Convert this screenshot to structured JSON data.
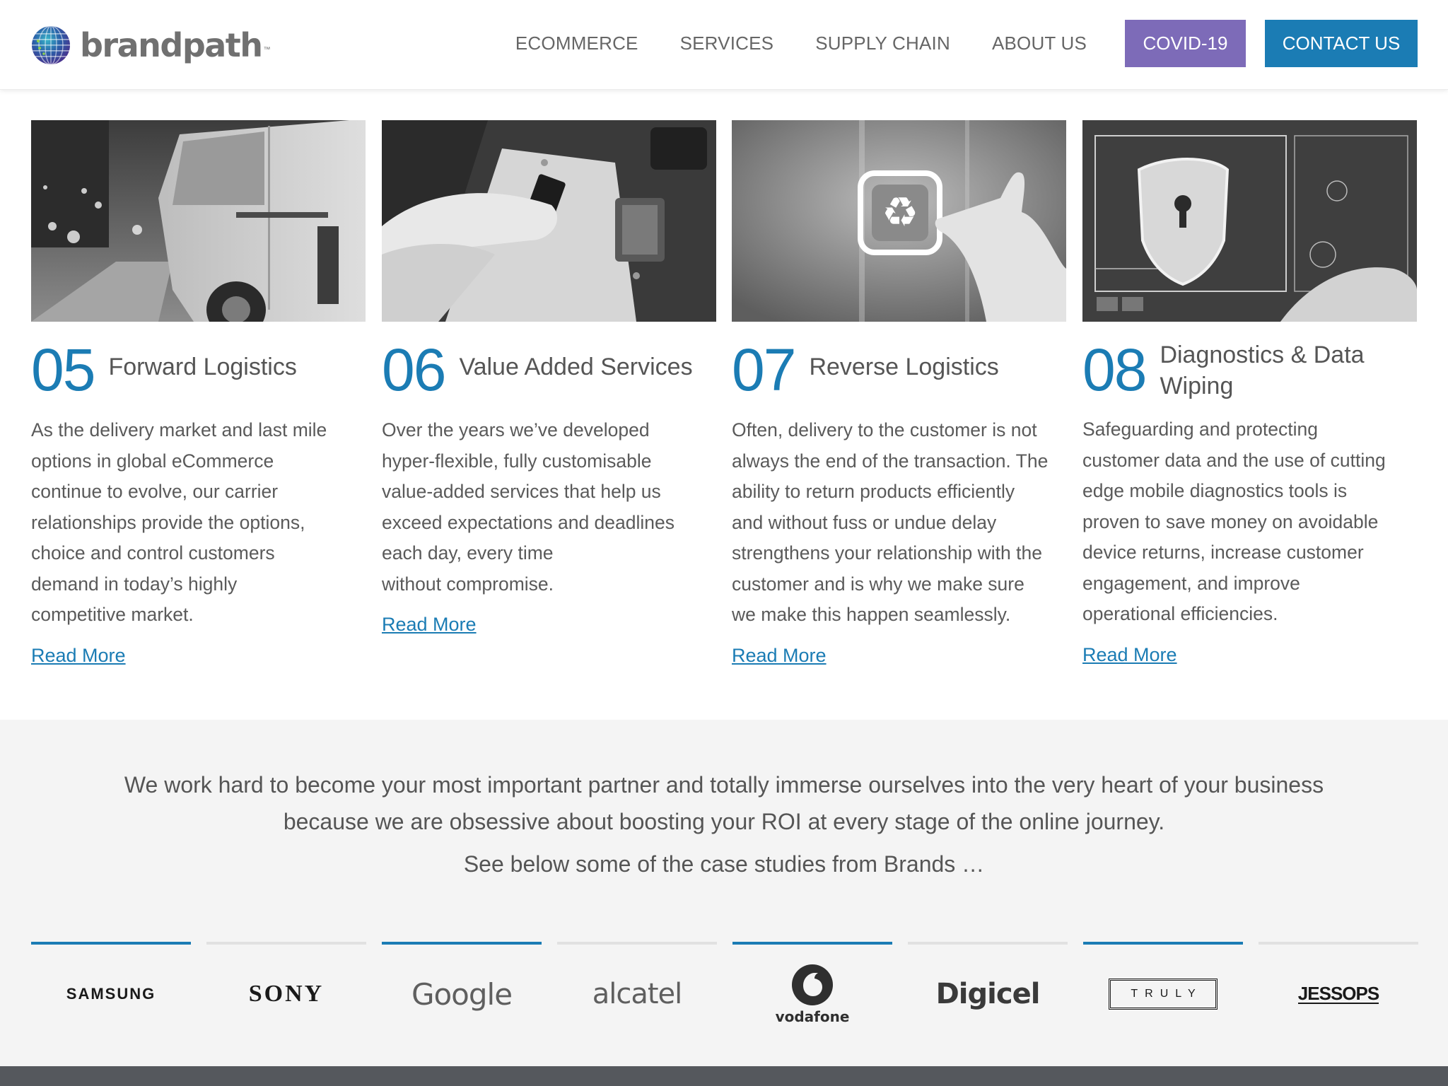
{
  "header": {
    "logo_text": "brandpath",
    "logo_tm": "™",
    "nav": [
      "ECOMMERCE",
      "SERVICES",
      "SUPPLY CHAIN",
      "ABOUT US"
    ],
    "covid_label": "COVID-19",
    "contact_label": "CONTACT US"
  },
  "cards": [
    {
      "number": "05",
      "title": "Forward Logistics",
      "text": [
        "As the delivery market and last mile",
        "options in global eCommerce",
        "continue to evolve, our carrier",
        "relationships provide the options,",
        "choice and control customers",
        "demand in today’s highly",
        "competitive market."
      ],
      "link": "Read More",
      "image": "van-icon"
    },
    {
      "number": "06",
      "title": "Value Added Services",
      "text": [
        "Over the years we’ve developed",
        "hyper-flexible, fully customisable",
        "value-added services that help us",
        "exceed expectations and deadlines",
        "each day, every time",
        "without compromise."
      ],
      "link": "Read More",
      "image": "sim-card-icon"
    },
    {
      "number": "07",
      "title": "Reverse Logistics",
      "text": [
        "Often, delivery to the customer is not",
        "always the end of the transaction. The",
        "ability to return products efficiently",
        "and without fuss or undue delay",
        "strengthens your relationship with the",
        "customer and is why we make sure",
        "we make this happen seamlessly."
      ],
      "link": "Read More",
      "image": "recycle-icon"
    },
    {
      "number": "08",
      "title_lines": [
        "Diagnostics & Data",
        "Wiping"
      ],
      "text": [
        "Safeguarding and protecting",
        "customer data and the use of cutting",
        "edge mobile diagnostics tools is",
        "proven to save money on avoidable",
        "device returns, increase customer",
        "engagement, and improve",
        "operational efficiencies."
      ],
      "link": "Read More",
      "image": "security-shield-icon"
    }
  ],
  "band": {
    "lead_lines": [
      "We work hard to become your most important partner and totally immerse ourselves into the very heart of your business",
      "because we are obsessive about boosting your ROI at every stage of the online journey."
    ],
    "sub": "See below some of the case studies from Brands …"
  },
  "brands": [
    {
      "name": "SAMSUNG",
      "active": true
    },
    {
      "name": "SONY",
      "active": false
    },
    {
      "name": "Google",
      "active": true
    },
    {
      "name": "alcatel",
      "active": false
    },
    {
      "name": "vodafone",
      "active": true
    },
    {
      "name": "Digicel",
      "active": false
    },
    {
      "name": "TRULY",
      "active": true
    },
    {
      "name": "JESSOPS",
      "active": false
    }
  ],
  "colors": {
    "accent": "#1b7cb4",
    "covid": "#7d6bb8",
    "band_bg": "#f4f4f4"
  }
}
